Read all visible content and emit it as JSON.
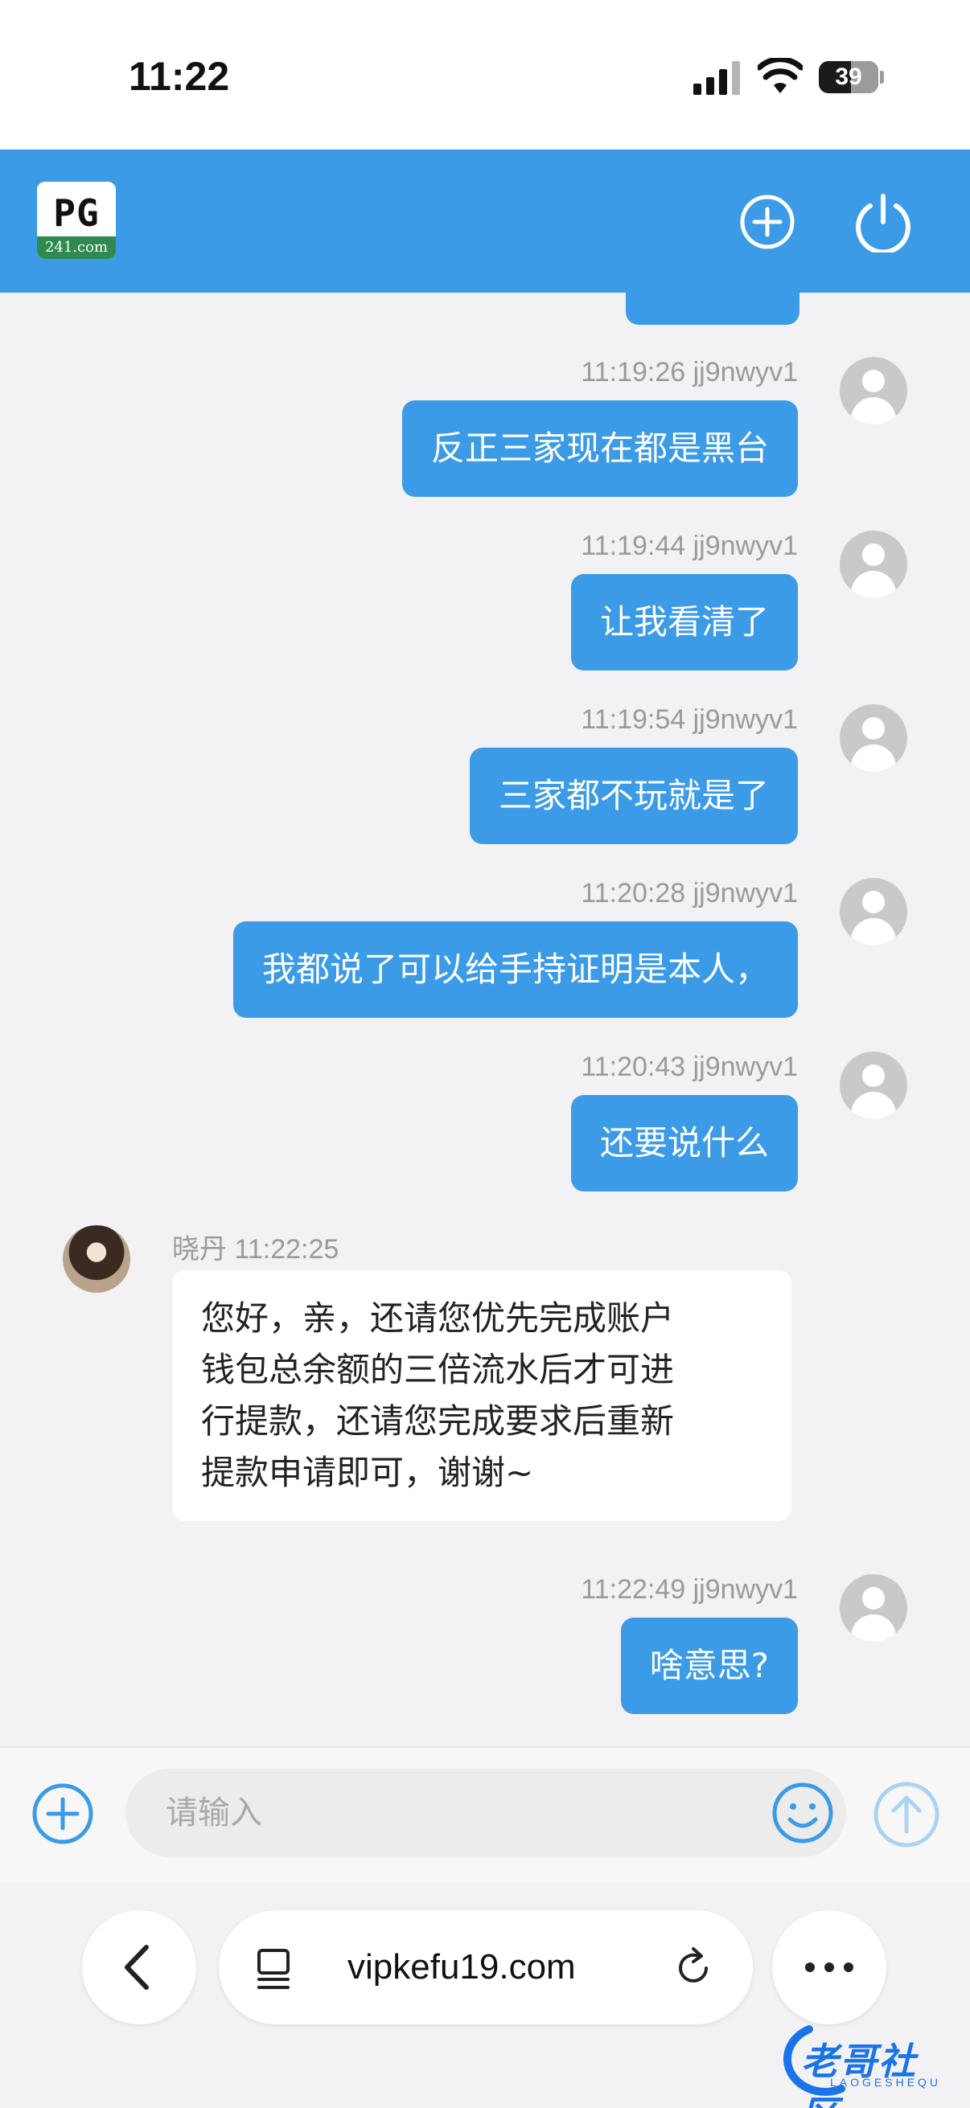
{
  "status_bar": {
    "time": "11:22",
    "battery": "39"
  },
  "header": {
    "logo_main": "PG",
    "logo_sub": "241.com",
    "add_icon": "plus-circle-icon",
    "power_icon": "power-icon"
  },
  "messages": [
    {
      "time": "11:19:26",
      "user": "jj9nwyv1",
      "text": "反正三家现在都是黑台"
    },
    {
      "time": "11:19:44",
      "user": "jj9nwyv1",
      "text": "让我看清了"
    },
    {
      "time": "11:19:54",
      "user": "jj9nwyv1",
      "text": "三家都不玩就是了"
    },
    {
      "time": "11:20:28",
      "user": "jj9nwyv1",
      "text": "我都说了可以给手持证明是本人，"
    },
    {
      "time": "11:20:43",
      "user": "jj9nwyv1",
      "text": "还要说什么"
    },
    {
      "time": "11:22:49",
      "user": "jj9nwyv1",
      "text": "啥意思?"
    }
  ],
  "agent_message": {
    "name": "晓丹",
    "time": "11:22:25",
    "lines": [
      "您好，亲，还请您优先完成账户",
      "钱包总余额的三倍流水后才可进",
      "行提款，还请您完成要求后重新",
      "提款申请即可，谢谢~"
    ]
  },
  "input": {
    "placeholder": "请输入"
  },
  "browser": {
    "url": "vipkefu19.com"
  },
  "watermark": {
    "text": "老哥社区",
    "sub": "LAOGESHEQU"
  },
  "colors": {
    "accent": "#3b9be6",
    "background": "#f2f2f4"
  }
}
